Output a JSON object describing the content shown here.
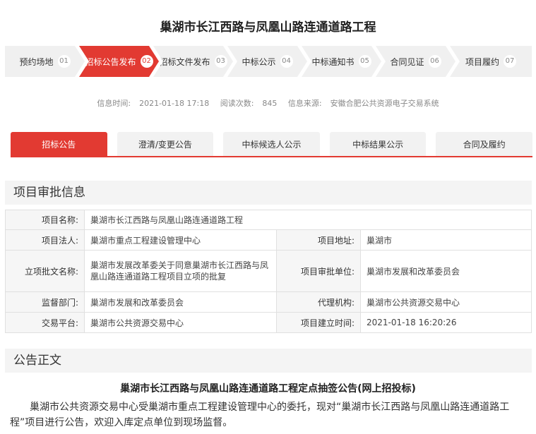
{
  "page": {
    "title": "巢湖市长江西路与凤凰山路连通道路工程"
  },
  "steps": [
    {
      "label": "预约场地",
      "num": "01",
      "active": false
    },
    {
      "label": "招标公告发布",
      "num": "02",
      "active": true
    },
    {
      "label": "招标文件发布",
      "num": "03",
      "active": false
    },
    {
      "label": "中标公示",
      "num": "04",
      "active": false
    },
    {
      "label": "中标通知书",
      "num": "05",
      "active": false
    },
    {
      "label": "合同见证",
      "num": "06",
      "active": false
    },
    {
      "label": "项目履约",
      "num": "07",
      "active": false
    }
  ],
  "info": {
    "time_label": "信息时间:",
    "time_value": "2021-01-18 17:18",
    "views_label": "阅读次数:",
    "views_value": "845",
    "source_label": "信息来源:",
    "source_value": "安徽合肥公共资源电子交易系统"
  },
  "tabs": [
    {
      "label": "招标公告",
      "active": true
    },
    {
      "label": "澄清/变更公告",
      "active": false
    },
    {
      "label": "中标候选人公示",
      "active": false
    },
    {
      "label": "中标结果公示",
      "active": false
    },
    {
      "label": "合同及履约",
      "active": false
    }
  ],
  "approval": {
    "heading": "项目审批信息",
    "project_name_label": "项目名称:",
    "project_name": "巢湖市长江西路与凤凰山路连通道路工程",
    "legal_person_label": "项目法人:",
    "legal_person": "巢湖市重点工程建设管理中心",
    "address_label": "项目地址:",
    "address": "巢湖市",
    "doc_label": "立项批文名称:",
    "doc": "巢湖市发展改革委关于同意巢湖市长江西路与凤凰山路连通道路工程项目立项的批复",
    "approver_label": "项目审批单位:",
    "approver": "巢湖市发展和改革委员会",
    "supervisor_label": "监督部门:",
    "supervisor": "巢湖市发展和改革委员会",
    "agency_label": "代理机构:",
    "agency": "巢湖市公共资源交易中心",
    "platform_label": "交易平台:",
    "platform": "巢湖市公共资源交易中心",
    "created_label": "项目建立时间:",
    "created": "2021-01-18 16:20:26"
  },
  "notice": {
    "heading": "公告正文",
    "title": "巢湖市长江西路与凤凰山路连通道路工程定点抽签公告(网上招投标)",
    "body": "巢湖市公共资源交易中心受巢湖市重点工程建设管理中心的委托，现对“巢湖市长江西路与凤凰山路连通道路工程”项目进行公告，欢迎入库定点单位到现场监督。"
  }
}
